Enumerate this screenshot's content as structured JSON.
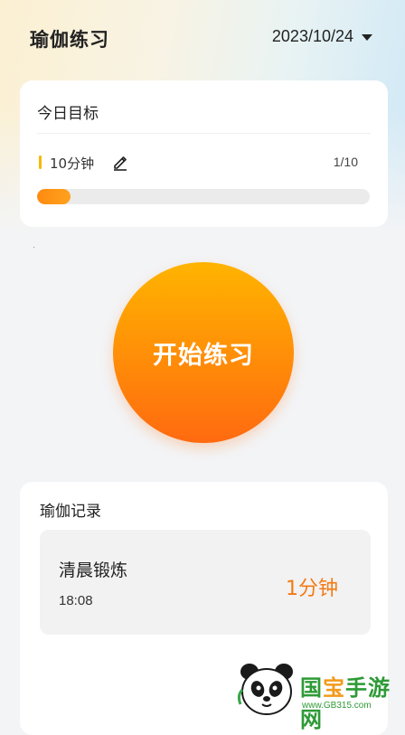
{
  "header": {
    "title": "瑜伽练习",
    "date": "2023/10/24"
  },
  "goal": {
    "title": "今日目标",
    "value": "10分钟",
    "progress_text": "1/10",
    "progress_fraction": 0.1
  },
  "start": {
    "label": "开始练习"
  },
  "records": {
    "title": "瑜伽记录",
    "items": [
      {
        "name": "清晨锻炼",
        "time": "18:08",
        "duration": "1分钟"
      }
    ]
  },
  "watermark": {
    "name": "国宝手游网",
    "url": "www.GB315.com"
  },
  "colors": {
    "accent": "#ff8c08",
    "goal_mark": "#f5b800",
    "duration_text": "#f47a12",
    "watermark_green": "#2e9a36"
  }
}
